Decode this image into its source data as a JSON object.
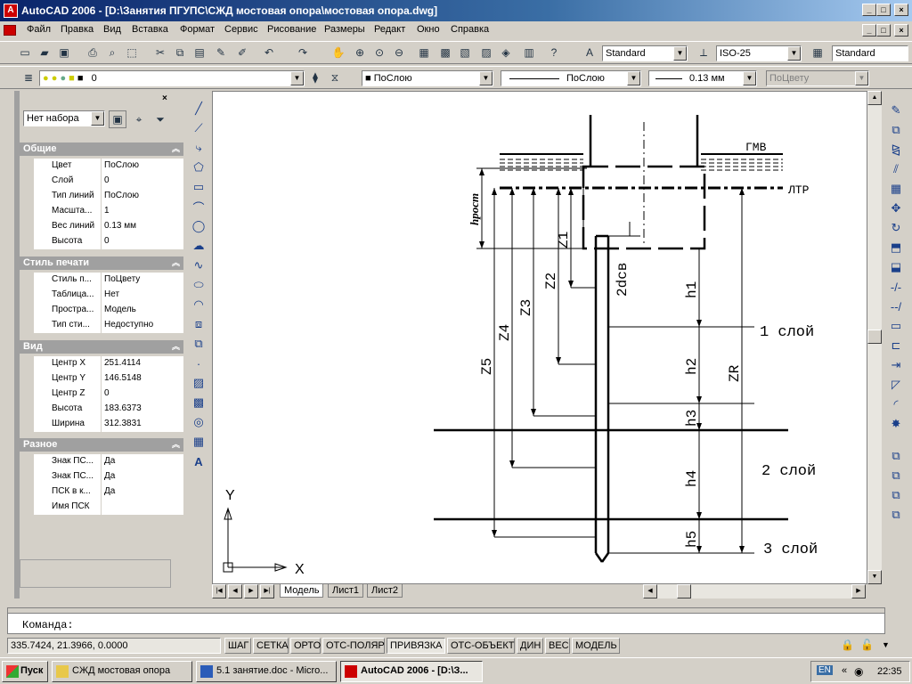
{
  "window": {
    "title": "AutoCAD 2006 - [D:\\Занятия ПГУПС\\СЖД мостовая опора\\мостовая опора.dwg]",
    "app_icon": "A"
  },
  "menu": [
    "Файл",
    "Правка",
    "Вид",
    "Вставка",
    "Формат",
    "Сервис",
    "Рисование",
    "Размеры",
    "Редакт",
    "Окно",
    "Справка"
  ],
  "toolbar": {
    "text_style": "Standard",
    "dim_style": "ISO-25",
    "table_style": "Standard",
    "layer": "0",
    "color": "ПоСлою",
    "linetype": "ПоСлою",
    "lineweight": "0.13 мм",
    "plotstyle": "ПоЦвету"
  },
  "properties": {
    "selection": "Нет набора",
    "sections": [
      {
        "title": "Общие",
        "rows": [
          {
            "k": "Цвет",
            "v": "ПоСлою"
          },
          {
            "k": "Слой",
            "v": "0"
          },
          {
            "k": "Тип линий",
            "v": "ПоСлою"
          },
          {
            "k": "Масшта...",
            "v": "1"
          },
          {
            "k": "Вес линий",
            "v": "0.13 мм"
          },
          {
            "k": "Высота",
            "v": "0"
          }
        ]
      },
      {
        "title": "Стиль печати",
        "rows": [
          {
            "k": "Стиль п...",
            "v": "ПоЦвету"
          },
          {
            "k": "Таблица...",
            "v": "Нет"
          },
          {
            "k": "Простра...",
            "v": "Модель"
          },
          {
            "k": "Тип сти...",
            "v": "Недоступно"
          }
        ]
      },
      {
        "title": "Вид",
        "rows": [
          {
            "k": "Центр X",
            "v": "251.4114"
          },
          {
            "k": "Центр Y",
            "v": "146.5148"
          },
          {
            "k": "Центр Z",
            "v": "0"
          },
          {
            "k": "Высота",
            "v": "183.6373"
          },
          {
            "k": "Ширина",
            "v": "312.3831"
          }
        ]
      },
      {
        "title": "Разное",
        "rows": [
          {
            "k": "Знак ПС...",
            "v": "Да"
          },
          {
            "k": "Знак ПС...",
            "v": "Да"
          },
          {
            "k": "ПСК в к...",
            "v": "Да"
          },
          {
            "k": "Имя ПСК",
            "v": ""
          }
        ]
      }
    ]
  },
  "drawing": {
    "labels": {
      "gmv": "ГМВ",
      "ltr": "ЛТР",
      "h_rost": "hрост",
      "z1": "Z1",
      "z2": "Z2",
      "z3": "Z3",
      "z4": "Z4",
      "z5": "Z5",
      "zr": "ZR",
      "d2": "2dсв",
      "h1": "h1",
      "h2": "h2",
      "h3": "h3",
      "h4": "h4",
      "h5": "h5",
      "layer1": "1 слой",
      "layer2": "2 слой",
      "layer3": "3 слой",
      "axis_y": "Y",
      "axis_x": "X"
    }
  },
  "layout_tabs": [
    "Модель",
    "Лист1",
    "Лист2"
  ],
  "command": {
    "prompt": "Команда:"
  },
  "status": {
    "coords": "335.7424, 21.3966, 0.0000",
    "toggles": [
      {
        "label": "ШАГ",
        "on": false
      },
      {
        "label": "СЕТКА",
        "on": false
      },
      {
        "label": "ОРТО",
        "on": false
      },
      {
        "label": "ОТС-ПОЛЯР",
        "on": false
      },
      {
        "label": "ПРИВЯЗКА",
        "on": true
      },
      {
        "label": "ОТС-ОБЪЕКТ",
        "on": false
      },
      {
        "label": "ДИН",
        "on": false
      },
      {
        "label": "ВЕС",
        "on": false
      },
      {
        "label": "МОДЕЛЬ",
        "on": false
      }
    ]
  },
  "taskbar": {
    "start": "Пуск",
    "tasks": [
      {
        "label": "СЖД мостовая опора",
        "active": false
      },
      {
        "label": "5.1 занятие.doc - Micro...",
        "active": false
      },
      {
        "label": "AutoCAD 2006 - [D:\\З...",
        "active": true
      }
    ],
    "lang": "EN",
    "clock": "22:35"
  }
}
